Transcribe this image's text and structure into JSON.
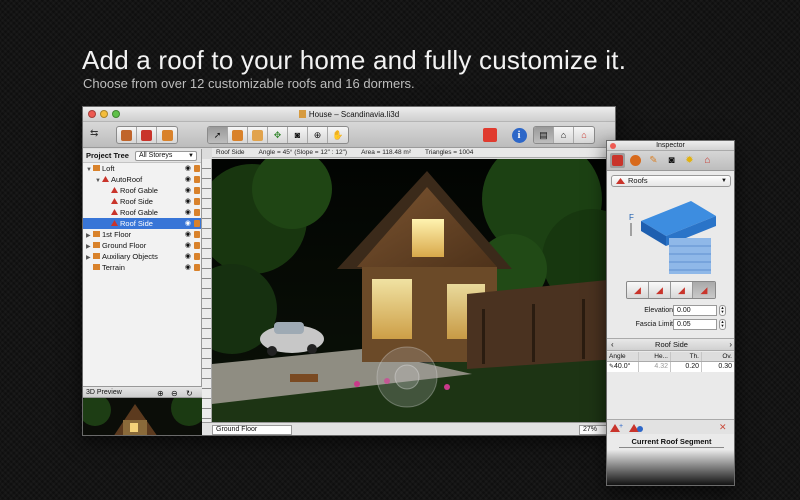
{
  "promo": {
    "headline": "Add a roof to your home and fully customize it.",
    "subline": "Choose from over 12 customizable roofs and 16 dormers."
  },
  "window": {
    "title": "House – Scandinavia.li3d"
  },
  "infobar": {
    "mode": "Roof Side",
    "angle": "Angle = 45° (Slope = 12\" : 12\")",
    "area": "Area = 118.48 m²",
    "triangles": "Triangles = 1004"
  },
  "project_tree": {
    "label": "Project Tree",
    "storey_filter": "All Storeys",
    "items": [
      {
        "label": "Loft",
        "level": 0,
        "expanded": true
      },
      {
        "label": "AutoRoof",
        "level": 1,
        "expanded": true
      },
      {
        "label": "Roof Gable",
        "level": 2
      },
      {
        "label": "Roof Side",
        "level": 2
      },
      {
        "label": "Roof Gable",
        "level": 2
      },
      {
        "label": "Roof Side",
        "level": 2,
        "selected": true
      },
      {
        "label": "1st Floor",
        "level": 0,
        "expanded": false
      },
      {
        "label": "Ground Floor",
        "level": 0,
        "expanded": false
      },
      {
        "label": "Auxiliary Objects",
        "level": 0,
        "expanded": false
      },
      {
        "label": "Terrain",
        "level": 0
      }
    ]
  },
  "preview": {
    "label": "3D Preview"
  },
  "bottombar": {
    "floor": "Ground Floor",
    "zoom": "27%"
  },
  "inspector": {
    "title": "Inspector",
    "category": "Roofs",
    "elevation_label": "Elevation",
    "elevation_value": "0.00",
    "fascia_label": "Fascia Limit",
    "fascia_value": "0.05",
    "segment_nav_label": "Roof Side",
    "table_headers": [
      "Angle",
      "He...",
      "Th.",
      "Ov."
    ],
    "table_rows": [
      {
        "angle": "40.0°",
        "height": "4.32",
        "thickness": "0.20",
        "overhang": "0.30"
      }
    ],
    "current_segment_label": "Current Roof Segment"
  },
  "colors": {
    "selection": "#3875d7",
    "accent_red": "#c9342b",
    "accent_orange": "#d9822b"
  }
}
